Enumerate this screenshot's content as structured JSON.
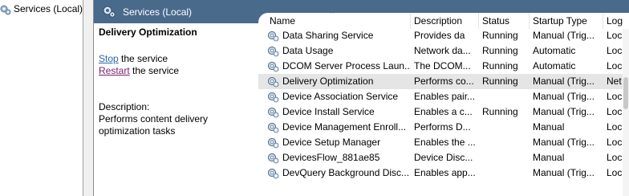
{
  "tree": {
    "root_label": "Services (Local)"
  },
  "header": {
    "title": "Services (Local)"
  },
  "details": {
    "service_name": "Delivery Optimization",
    "stop_link": "Stop",
    "stop_suffix": " the service",
    "restart_link": "Restart",
    "restart_suffix": " the service",
    "description_label": "Description:",
    "description_line1": "Performs content delivery",
    "description_line2": "optimization tasks"
  },
  "table": {
    "columns": [
      "Name",
      "Description",
      "Status",
      "Startup Type",
      "Log"
    ],
    "rows": [
      {
        "name": "Data Sharing Service",
        "description": "Provides da",
        "status": "Running",
        "startup": "Manual (Trig...",
        "logon": "Loc"
      },
      {
        "name": "Data Usage",
        "description": "Network da...",
        "status": "Running",
        "startup": "Automatic",
        "logon": "Loc"
      },
      {
        "name": "DCOM Server Process Laun...",
        "description": "The DCOM...",
        "status": "Running",
        "startup": "Automatic",
        "logon": "Loc"
      },
      {
        "name": "Delivery Optimization",
        "description": "Performs co...",
        "status": "Running",
        "startup": "Manual (Trig...",
        "logon": "Net"
      },
      {
        "name": "Device Association Service",
        "description": "Enables pair...",
        "status": "",
        "startup": "Manual (Trig...",
        "logon": "Loc"
      },
      {
        "name": "Device Install Service",
        "description": "Enables a c...",
        "status": "Running",
        "startup": "Manual (Trig...",
        "logon": "Loc"
      },
      {
        "name": "Device Management Enroll...",
        "description": "Performs D...",
        "status": "",
        "startup": "Manual",
        "logon": "Loc"
      },
      {
        "name": "Device Setup Manager",
        "description": "Enables the ...",
        "status": "",
        "startup": "Manual (Trig...",
        "logon": "Loc"
      },
      {
        "name": "DevicesFlow_881ae85",
        "description": "Device Disc...",
        "status": "",
        "startup": "Manual",
        "logon": "Loc"
      },
      {
        "name": "DevQuery Background Disc...",
        "description": "Enables app...",
        "status": "",
        "startup": "Manual (Trig...",
        "logon": "Loc"
      }
    ]
  },
  "colors": {
    "header_bg": "#4a6a8c",
    "link": "#2b66a8",
    "visited_link": "#7a1d6e",
    "selected_row": "#e5e5e5"
  },
  "icons": {
    "tree": "services-gear-icon",
    "header": "services-gear-icon",
    "row": "gear-icon"
  }
}
